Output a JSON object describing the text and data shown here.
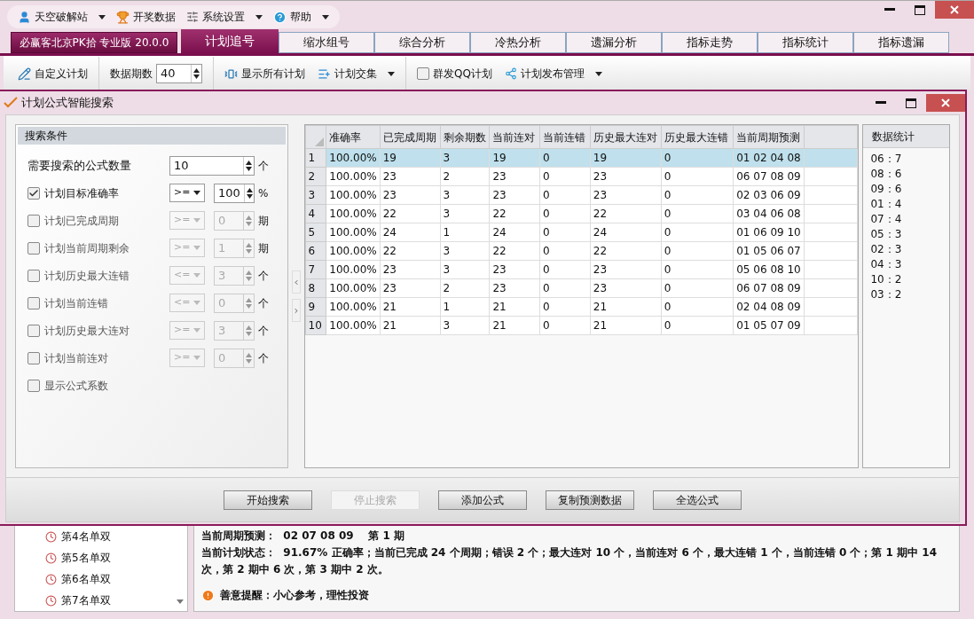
{
  "main_window": {
    "menu": [
      {
        "label": "天空破解站",
        "dropdown": true
      },
      {
        "label": "开奖数据",
        "dropdown": false
      },
      {
        "label": "系统设置",
        "dropdown": true
      },
      {
        "label": "帮助",
        "dropdown": true
      }
    ],
    "tabs": [
      {
        "kind": "app",
        "label": "必赢客北京PK拾 专业版 20.0.0",
        "selected": false
      },
      {
        "kind": "tab",
        "label": "计划追号",
        "selected": true
      },
      {
        "kind": "tab",
        "label": "缩水组号",
        "selected": false
      },
      {
        "kind": "tab",
        "label": "综合分析",
        "selected": false
      },
      {
        "kind": "tab",
        "label": "冷热分析",
        "selected": false
      },
      {
        "kind": "tab",
        "label": "遗漏分析",
        "selected": false
      },
      {
        "kind": "tab",
        "label": "指标走势",
        "selected": false
      },
      {
        "kind": "tab",
        "label": "指标统计",
        "selected": false
      },
      {
        "kind": "tab",
        "label": "指标遗漏",
        "selected": false
      }
    ],
    "ribbon": [
      {
        "kind": "button",
        "label": "自定义计划",
        "divider_after": true
      },
      {
        "kind": "spinner",
        "label": "数据期数",
        "value": "40",
        "divider_after": true
      },
      {
        "kind": "button",
        "label": "显示所有计划",
        "divider_after": false
      },
      {
        "kind": "menu",
        "label": "计划交集",
        "divider_after": true
      },
      {
        "kind": "checkbox",
        "label": "群发QQ计划",
        "checked": false,
        "divider_after": false
      },
      {
        "kind": "menu",
        "label": "计划发布管理",
        "divider_after": false
      }
    ],
    "plan_list": [
      "第4名单双",
      "第5名单双",
      "第6名单双",
      "第7名单双"
    ],
    "status_lines": [
      "当前周期预测：  02 07 08 09    第 1 期",
      "当前计划状态：  91.67% 正确率；当前已完成 24 个周期；错误 2 个；最大连对 10 个，当前连对 6 个，最大连错 1 个，当前连错 0 个；第 1 期中 14 次，第 2 期中 6 次，第 3 期中 2 次。"
    ],
    "reminder": "善意提醒：小心参考，理性投资"
  },
  "dialog": {
    "title": "计划公式智能搜索",
    "conditions_header": "搜索条件",
    "conditions": [
      {
        "kind": "number",
        "label": "需要搜索的公式数量",
        "value": "10",
        "unit": "个"
      },
      {
        "kind": "condition",
        "label": "计划目标准确率",
        "checked": true,
        "operator": ">=",
        "value": "100",
        "unit": "%"
      },
      {
        "kind": "condition",
        "label": "计划已完成周期",
        "checked": false,
        "operator": ">=",
        "value": "0",
        "unit": "期"
      },
      {
        "kind": "condition",
        "label": "计划当前周期剩余",
        "checked": false,
        "operator": ">=",
        "value": "1",
        "unit": "期"
      },
      {
        "kind": "condition",
        "label": "计划历史最大连错",
        "checked": false,
        "operator": "<=",
        "value": "3",
        "unit": "个"
      },
      {
        "kind": "condition",
        "label": "计划当前连错",
        "checked": false,
        "operator": "<=",
        "value": "0",
        "unit": "个"
      },
      {
        "kind": "condition",
        "label": "计划历史最大连对",
        "checked": false,
        "operator": ">=",
        "value": "3",
        "unit": "个"
      },
      {
        "kind": "condition",
        "label": "计划当前连对",
        "checked": false,
        "operator": ">=",
        "value": "0",
        "unit": "个"
      },
      {
        "kind": "checkbox",
        "label": "显示公式系数",
        "checked": false
      }
    ],
    "table": {
      "columns": [
        "准确率",
        "已完成周期",
        "剩余期数",
        "当前连对",
        "当前连错",
        "历史最大连对",
        "历史最大连错",
        "当前周期预测"
      ],
      "rows": [
        {
          "index": "1",
          "selected": true,
          "cells": [
            "100.00%",
            "19",
            "3",
            "19",
            "0",
            "19",
            "0",
            "01 02 04 08"
          ]
        },
        {
          "index": "2",
          "selected": false,
          "cells": [
            "100.00%",
            "23",
            "2",
            "23",
            "0",
            "23",
            "0",
            "06 07 08 09"
          ]
        },
        {
          "index": "3",
          "selected": false,
          "cells": [
            "100.00%",
            "23",
            "3",
            "23",
            "0",
            "23",
            "0",
            "02 03 06 09"
          ]
        },
        {
          "index": "4",
          "selected": false,
          "cells": [
            "100.00%",
            "22",
            "3",
            "22",
            "0",
            "22",
            "0",
            "03 04 06 08"
          ]
        },
        {
          "index": "5",
          "selected": false,
          "cells": [
            "100.00%",
            "24",
            "1",
            "24",
            "0",
            "24",
            "0",
            "01 06 09 10"
          ]
        },
        {
          "index": "6",
          "selected": false,
          "cells": [
            "100.00%",
            "22",
            "3",
            "22",
            "0",
            "22",
            "0",
            "01 05 06 07"
          ]
        },
        {
          "index": "7",
          "selected": false,
          "cells": [
            "100.00%",
            "23",
            "3",
            "23",
            "0",
            "23",
            "0",
            "05 06 08 10"
          ]
        },
        {
          "index": "8",
          "selected": false,
          "cells": [
            "100.00%",
            "23",
            "2",
            "23",
            "0",
            "23",
            "0",
            "06 07 08 09"
          ]
        },
        {
          "index": "9",
          "selected": false,
          "cells": [
            "100.00%",
            "21",
            "1",
            "21",
            "0",
            "21",
            "0",
            "02 04 08 09"
          ]
        },
        {
          "index": "10",
          "selected": false,
          "cells": [
            "100.00%",
            "21",
            "3",
            "21",
            "0",
            "21",
            "0",
            "01 05 07 09"
          ]
        }
      ]
    },
    "stats_header": "数据统计",
    "stats": [
      "06：7",
      "08：6",
      "09：6",
      "01：4",
      "07：4",
      "05：3",
      "02：3",
      "04：3",
      "10：2",
      "03：2"
    ],
    "buttons": [
      {
        "label": "开始搜索",
        "disabled": false
      },
      {
        "label": "停止搜索",
        "disabled": true
      },
      {
        "label": "添加公式",
        "disabled": false
      },
      {
        "label": "复制预测数据",
        "disabled": false
      },
      {
        "label": "全选公式",
        "disabled": false
      }
    ]
  }
}
